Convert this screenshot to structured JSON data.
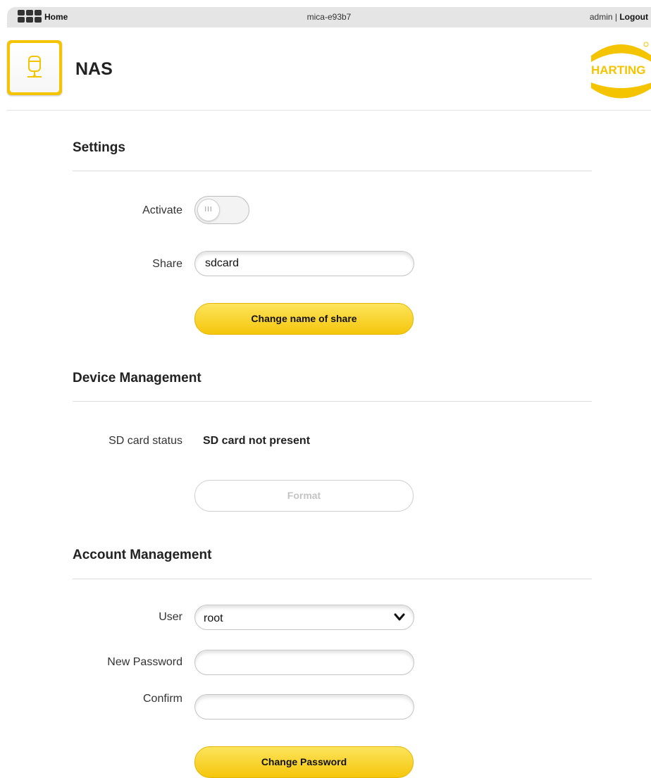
{
  "topbar": {
    "home_label": "Home",
    "device_name": "mica-e93b7",
    "user": "admin",
    "separator": "|",
    "logout_label": "Logout"
  },
  "header": {
    "title": "NAS",
    "logo_text": "HARTING",
    "icon": "nas-storage-icon"
  },
  "settings": {
    "title": "Settings",
    "activate_label": "Activate",
    "activate_state": "off",
    "toggle_glyph": "III",
    "share_label": "Share",
    "share_value": "sdcard",
    "change_share_button": "Change name of share"
  },
  "device_management": {
    "title": "Device Management",
    "sd_status_label": "SD card status",
    "sd_status_value": "SD card not present",
    "format_button": "Format"
  },
  "account_management": {
    "title": "Account Management",
    "user_label": "User",
    "user_selected": "root",
    "new_password_label": "New Password",
    "new_password_value": "",
    "confirm_label": "Confirm",
    "confirm_value": "",
    "change_password_button": "Change Password"
  },
  "colors": {
    "accent": "#f5c400",
    "topbar_bg": "#e5e5e5"
  }
}
